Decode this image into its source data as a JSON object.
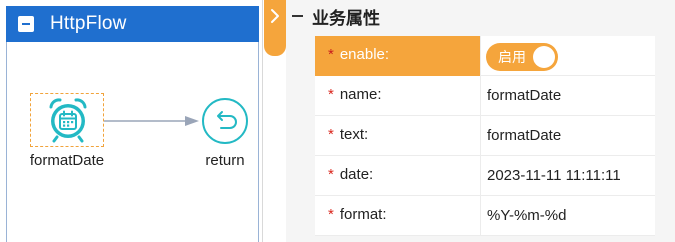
{
  "flow": {
    "title": "HttpFlow",
    "nodes": [
      {
        "label": "formatDate",
        "icon": "alarm-clock-calendar-icon"
      },
      {
        "label": "return",
        "icon": "return-arrow-icon"
      }
    ]
  },
  "props": {
    "section_title": "业务属性",
    "rows": [
      {
        "key": "enable:",
        "toggle_label": "启用",
        "enabled": true
      },
      {
        "key": "name:",
        "value": "formatDate"
      },
      {
        "key": "text:",
        "value": "formatDate"
      },
      {
        "key": "date:",
        "value": "2023-11-11 11:11:11"
      },
      {
        "key": "format:",
        "value": "%Y-%m-%d"
      }
    ],
    "required_mark": "*"
  },
  "colors": {
    "header_blue": "#1f6fcf",
    "accent_orange": "#f5a53c",
    "node_teal": "#23b9c4",
    "required_red": "#d9261c"
  }
}
